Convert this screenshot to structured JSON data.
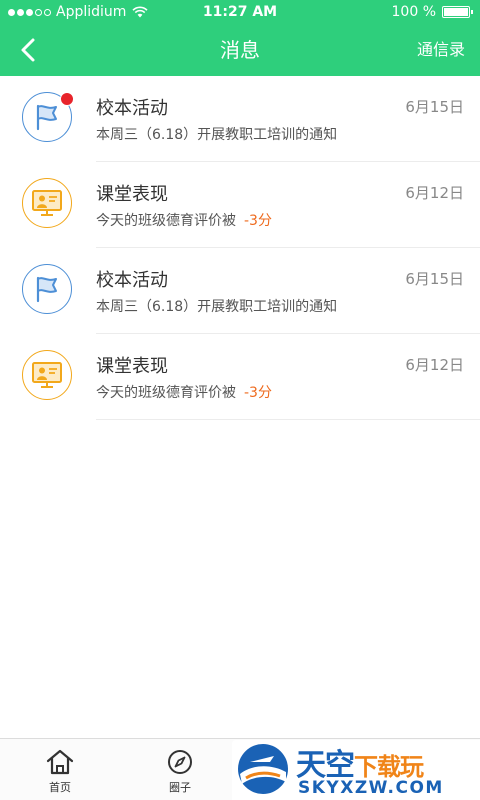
{
  "status_bar": {
    "carrier": "Applidium",
    "time": "11:27 AM",
    "battery": "100 %"
  },
  "nav": {
    "back_icon": "chevron-left-icon",
    "title": "消息",
    "right_label": "通信录"
  },
  "messages": [
    {
      "title": "校本活动",
      "date": "6月15日",
      "preview": "本周三（6.18）开展教职工培训的通知",
      "score": "",
      "icon": "flag-icon",
      "unread": true
    },
    {
      "title": "课堂表现",
      "date": "6月12日",
      "preview": "今天的班级德育评价被",
      "score": "-3分",
      "icon": "classroom-icon",
      "unread": false
    },
    {
      "title": "校本活动",
      "date": "6月15日",
      "preview": "本周三（6.18）开展教职工培训的通知",
      "score": "",
      "icon": "flag-icon",
      "unread": false
    },
    {
      "title": "课堂表现",
      "date": "6月12日",
      "preview": "今天的班级德育评价被",
      "score": "-3分",
      "icon": "classroom-icon",
      "unread": false
    }
  ],
  "tab_bar": {
    "items": [
      {
        "label": "首页",
        "icon": "home-icon"
      },
      {
        "label": "圈子",
        "icon": "compass-icon"
      }
    ]
  },
  "watermark": {
    "text_main": "天空",
    "text_accent": "下载玩",
    "text_url": "SKYXZW.COM"
  },
  "colors": {
    "header": "#2ecf7c",
    "flag_blue": "#4d8fd6",
    "classroom_orange": "#f2a81b",
    "unread_red": "#e8242b",
    "score_orange": "#ee6b1f"
  }
}
